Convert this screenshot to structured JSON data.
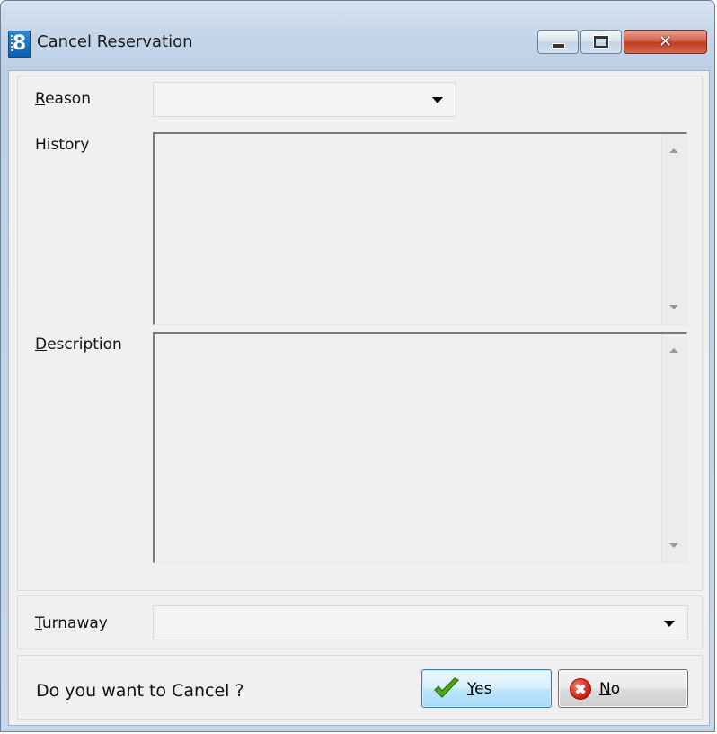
{
  "window": {
    "title": "Cancel Reservation",
    "icon": "app-8-icon",
    "icon_text": "8",
    "controls": [
      "minimize-icon",
      "maximize-icon",
      "close-icon"
    ],
    "close_glyph": "✕"
  },
  "form": {
    "reason": {
      "label_mnemonic": "R",
      "label_rest": "eason",
      "value": ""
    },
    "history": {
      "label": "History",
      "value": ""
    },
    "description": {
      "label_mnemonic": "D",
      "label_rest": "escription",
      "value": ""
    },
    "turnaway": {
      "label_mnemonic": "T",
      "label_rest": "urnaway",
      "value": ""
    }
  },
  "footer": {
    "prompt": "Do you want to Cancel ?",
    "yes": {
      "mnemonic": "Y",
      "rest": "es",
      "icon": "checkmark-icon"
    },
    "no": {
      "mnemonic": "N",
      "rest": "o",
      "icon": "cancel-circle-icon"
    }
  },
  "colors": {
    "window_frame": "#c4d5e9",
    "client_bg": "#f0f0f0",
    "close_button": "#c03a22",
    "yes_button": "#bee6fd",
    "check_green": "#4caa1c",
    "no_red": "#c91c10"
  }
}
